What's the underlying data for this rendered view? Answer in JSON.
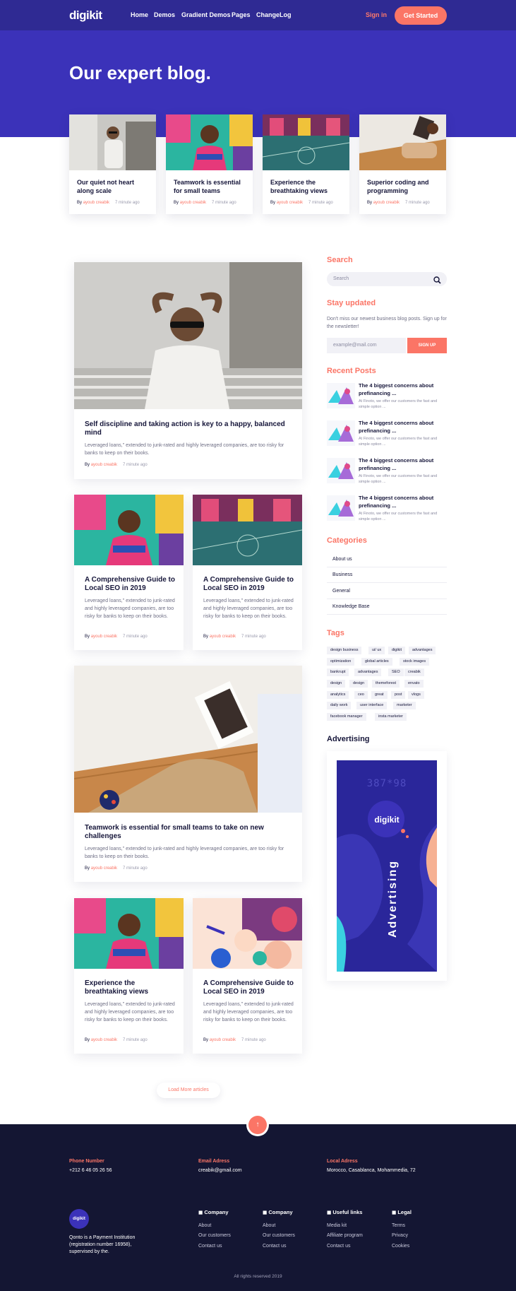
{
  "header": {
    "logo": "digikit",
    "nav": [
      "Home",
      "Demos",
      "Gradient Demos",
      "Pages",
      "ChangeLog"
    ],
    "signin": "Sign in",
    "get_started": "Get Started"
  },
  "hero": {
    "title": "Our expert blog."
  },
  "featured": [
    {
      "title": "Our quiet not heart along scale",
      "by": "By",
      "author": "ayoub creabik",
      "ago": "7 minute ago"
    },
    {
      "title": "Teamwork is essential for small teams",
      "by": "By",
      "author": "ayoub creabik",
      "ago": "7 minute ago"
    },
    {
      "title": "Experience the breathtaking views",
      "by": "By",
      "author": "ayoub creabik",
      "ago": "7 minute ago"
    },
    {
      "title": "Superior coding and programming",
      "by": "By",
      "author": "ayoub creabik",
      "ago": "7 minute ago"
    }
  ],
  "posts": [
    {
      "title": "Self discipline and taking action is key to a happy, balanced mind",
      "excerpt": "Leveraged loans,\" extended to junk-rated and highly leveraged companies, are too risky for banks to keep on their books.",
      "by": "By",
      "author": "ayoub creabik",
      "ago": "7 minute ago"
    },
    {
      "title": "A Comprehensive Guide to Local SEO in 2019",
      "excerpt": "Leveraged loans,\" extended to junk-rated and highly leveraged companies, are too risky for banks to keep on their books.",
      "by": "By",
      "author": "ayoub creabik",
      "ago": "7 minute ago"
    },
    {
      "title": "A Comprehensive Guide to Local SEO in 2019",
      "excerpt": "Leveraged loans,\" extended to junk-rated and highly leveraged companies, are too risky for banks to keep on their books.",
      "by": "By",
      "author": "ayoub creabik",
      "ago": "7 minute ago"
    },
    {
      "title": "Teamwork is essential for small teams to take on new challenges",
      "excerpt": "Leveraged loans,\" extended to junk-rated and highly leveraged companies, are too risky for banks to keep on their books.",
      "by": "By",
      "author": "ayoub creabik",
      "ago": "7 minute ago"
    },
    {
      "title": "Experience the breathtaking views",
      "excerpt": "Leveraged loans,\" extended to junk-rated and highly leveraged companies, are too risky for banks to keep on their books.",
      "by": "By",
      "author": "ayoub creabik",
      "ago": "7 minute ago"
    },
    {
      "title": "A Comprehensive Guide to Local SEO in 2019",
      "excerpt": "Leveraged loans,\" extended to junk-rated and highly leveraged companies, are too risky for banks to keep on their books.",
      "by": "By",
      "author": "ayoub creabik",
      "ago": "7 minute ago"
    }
  ],
  "load_more": "Load More articles",
  "sidebar": {
    "search_title": "Search",
    "search_placeholder": "Search",
    "stay_title": "Stay updated",
    "stay_text": "Don't miss our newest business blog posts. Sign up for the newsletter!",
    "email_placeholder": "example@mail.com",
    "signup": "SIGN UP",
    "recent_title": "Recent Posts",
    "recent": [
      {
        "title": "The 4 biggest concerns about prefinancing ...",
        "text": "At Finoto, we offer our customers the fast and simple option ..."
      },
      {
        "title": "The 4 biggest concerns about prefinancing ...",
        "text": "At Finoto, we offer our customers the fast and simple option ..."
      },
      {
        "title": "The 4 biggest concerns about prefinancing ...",
        "text": "At Finoto, we offer our customers the fast and simple option ..."
      },
      {
        "title": "The 4 biggest concerns about prefinancing ...",
        "text": "At Finoto, we offer our customers the fast and simple option ..."
      }
    ],
    "categories_title": "Categories",
    "categories": [
      "About us",
      "Business",
      "General",
      "Knowledge Base"
    ],
    "tags_title": "Tags",
    "tags": [
      "design business",
      "ui/ ux",
      "digikit",
      "advantages",
      "optimization",
      "global articles",
      "stock images",
      "bankrupt",
      "advantages",
      "SEO",
      "creabik",
      "design",
      "design",
      "themeforest",
      "envato",
      "analytics",
      "ceo",
      "great",
      "post",
      "vlogs",
      "daily work",
      "user interface",
      "marketer",
      "facebook manager",
      "insta marketer"
    ],
    "ad_title": "Advertising",
    "ad_size": "387*98",
    "ad_logo": "digikit",
    "ad_label": "Advertising"
  },
  "footer": {
    "phone_label": "Phone Number",
    "phone": "+212 6 46 05 26 56",
    "email_label": "Email Adress",
    "email": "creabik@gmail.com",
    "local_label": "Local Adress",
    "local": "Morocco, Casablanca, Mohammedia, 72",
    "logo": "digikit",
    "description": "Qonto is a Payment Institution (registration number 16958), supervised by the.",
    "columns": [
      {
        "title": "Company",
        "links": [
          "About",
          "Our customers",
          "Contact us"
        ]
      },
      {
        "title": "Company",
        "links": [
          "About",
          "Our customers",
          "Contact us"
        ]
      },
      {
        "title": "Useful links",
        "links": [
          "Media kit",
          "Affiliate program",
          "Contact us"
        ]
      },
      {
        "title": "Legal",
        "links": [
          "Terms",
          "Privacy",
          "Cookies"
        ]
      }
    ],
    "copyright": "All rights reserved 2019"
  },
  "colors": {
    "primary": "#3b32b9",
    "accent": "#fb7566",
    "footer": "#141633"
  }
}
